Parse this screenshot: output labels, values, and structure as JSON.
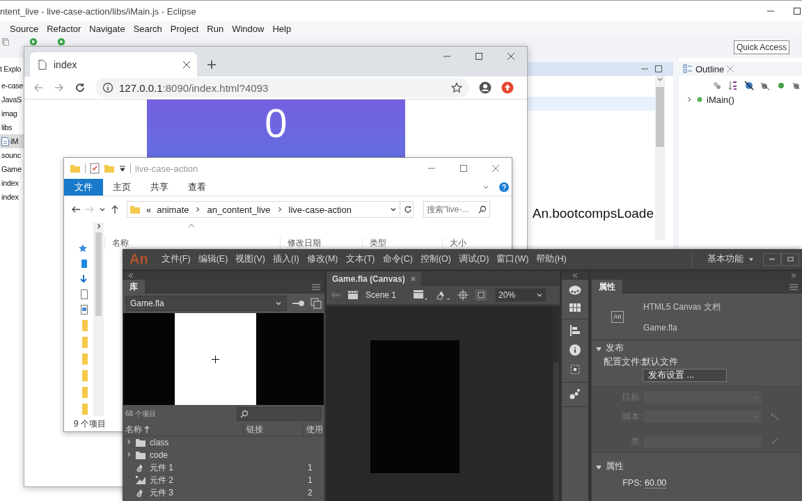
{
  "eclipse": {
    "title": "ntent_live - live-case-action/libs/iMain.js - Eclipse",
    "menu": [
      "Source",
      "Refactor",
      "Navigate",
      "Search",
      "Project",
      "Run",
      "Window",
      "Help"
    ],
    "quick_access": {
      "placeholder": "Quick Access"
    },
    "explorer": {
      "tab": "t Explo",
      "items": [
        {
          "label": "e-case",
          "kind": "node",
          "selected": false
        },
        {
          "label": "JavaS",
          "kind": "node",
          "selected": false
        },
        {
          "label": "imag",
          "kind": "node",
          "selected": false
        },
        {
          "label": "libs",
          "kind": "node",
          "selected": false
        },
        {
          "label": "iM",
          "kind": "file",
          "selected": true
        },
        {
          "label": "sounc",
          "kind": "node",
          "selected": false
        },
        {
          "label": "Game",
          "kind": "node",
          "selected": false
        },
        {
          "label": "index",
          "kind": "node",
          "selected": false
        },
        {
          "label": "index",
          "kind": "node",
          "selected": false
        }
      ]
    },
    "editor": {
      "code_line": "An.bootcompsLoade"
    },
    "outline": {
      "tab": "Outline",
      "items": [
        {
          "label": "iMain()",
          "expanded": false
        }
      ]
    }
  },
  "browser": {
    "tab": "index",
    "url_host": "127.0.0.1",
    "url_rest": ":8090/index.html?4093",
    "counter": "0"
  },
  "file_explorer": {
    "title": "live-case-action",
    "ribbon_tabs": [
      {
        "label": "文件",
        "selected": true
      },
      {
        "label": "主页",
        "selected": false
      },
      {
        "label": "共享",
        "selected": false
      },
      {
        "label": "查看",
        "selected": false
      }
    ],
    "path_prefix": "«",
    "path": [
      "animate",
      "an_content_live",
      "live-case-action"
    ],
    "search": {
      "placeholder": "搜索\"live-..."
    },
    "columns": [
      "名称",
      "修改日期",
      "类型",
      "大小"
    ],
    "status": "9 个项目"
  },
  "animate": {
    "logo": "An",
    "menu": [
      "文件(F)",
      "编辑(E)",
      "视图(V)",
      "插入(I)",
      "修改(M)",
      "文本(T)",
      "命令(C)",
      "控制(O)",
      "调试(D)",
      "窗口(W)",
      "帮助(H)"
    ],
    "workspace": "基本功能",
    "library": {
      "tab": "库",
      "document": "Game.fla",
      "count": "68 个项目",
      "columns": [
        "名称",
        "链接",
        "使用"
      ],
      "items": [
        {
          "label": "class",
          "kind": "folder",
          "expanded": false
        },
        {
          "label": "code",
          "kind": "folder",
          "expanded": false
        },
        {
          "label": "元件 1",
          "kind": "graphic",
          "uses": "1"
        },
        {
          "label": "元件 2",
          "kind": "movieclip",
          "uses": "1"
        },
        {
          "label": "元件 3",
          "kind": "graphic",
          "uses": "2"
        }
      ]
    },
    "document_tab": {
      "label": "Game.fla (Canvas)",
      "close": "×"
    },
    "scene": "Scene 1",
    "zoom": "20%",
    "properties": {
      "tab": "属性",
      "doc_icon_label": "An",
      "doc_type": "HTML5 Canvas 文档",
      "file": "Game.fla",
      "publish": {
        "label": "发布",
        "expanded": true,
        "profile_label": "配置文件:",
        "profile": "默认文件",
        "settings_button": "发布设置 ...",
        "fields": [
          {
            "label": "目标:",
            "kind": "select",
            "disabled": true
          },
          {
            "label": "脚本:",
            "kind": "select",
            "disabled": true
          },
          {
            "label": "类:",
            "kind": "text",
            "disabled": true
          }
        ]
      },
      "props": {
        "label": "属性",
        "expanded": true,
        "fps_label": "FPS:",
        "fps": "60.00"
      }
    }
  }
}
